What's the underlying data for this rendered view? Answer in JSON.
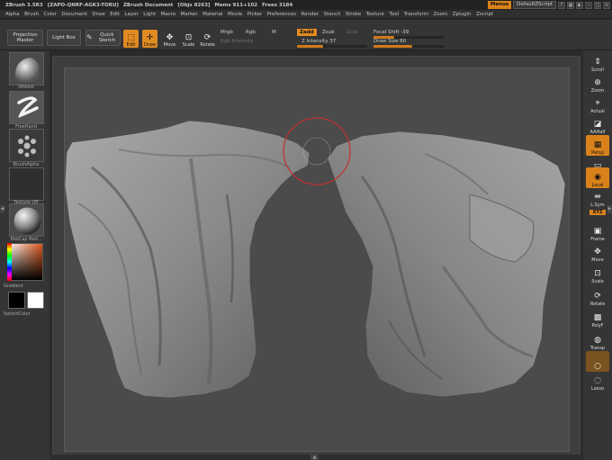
{
  "titlebar": {
    "app": "ZBrush 3.5R3",
    "serial": "[ZAPO-QNRF-AGK3-TORU]",
    "document": "ZBrush Document",
    "objs": "[Objs 8263]",
    "mems": "Mems 911+102",
    "frees": "Frees 3184",
    "menus": "Menus",
    "script": "DefaultZScript"
  },
  "menubar": [
    "Alpha",
    "Brush",
    "Color",
    "Document",
    "Draw",
    "Edit",
    "Layer",
    "Light",
    "Macro",
    "Marker",
    "Material",
    "Movie",
    "Picker",
    "Preferences",
    "Render",
    "Stencil",
    "Stroke",
    "Texture",
    "Tool",
    "Transform",
    "Zoom",
    "Zplugin",
    "Zscript"
  ],
  "toolbar": {
    "projection_master": "Projection Master",
    "light_box": "Light Box",
    "quick_sketch": "Quick Sketch",
    "edit": "Edit",
    "draw": "Draw",
    "move": "Move",
    "scale": "Scale",
    "rotate": "Rotate",
    "mrgb": "Mrgb",
    "rgb": "Rgb",
    "m": "M",
    "rgb_intensity": "Rgb Intensity",
    "zadd": "Zadd",
    "zsub": "Zsub",
    "zcut": "Zcut",
    "z_intensity_label": "Z Intensity",
    "z_intensity_value": "37",
    "focal_shift_label": "Focal Shift",
    "focal_shift_value": "-39",
    "draw_size_label": "Draw Size",
    "draw_size_value": "80"
  },
  "leftshelf": {
    "brush": "SPolish",
    "stroke": "FreeHand",
    "alpha": "BrushAlpha",
    "texture": "Texture Off",
    "material": "MatCap Red...",
    "gradient": "Gradient",
    "switch_color": "SwitchColor"
  },
  "rightshelf": [
    "Scroll",
    "Zoom",
    "Actual",
    "AAHalf",
    "Persp",
    "Floor",
    "Local",
    "L.Sym",
    "XYZ",
    "Frame",
    "Move",
    "Scale",
    "Rotate",
    "PolyF",
    "Transp",
    "Ghost",
    "Lasso"
  ],
  "colors": {
    "accent": "#e08a22",
    "background": "#353535",
    "canvas": "#4b4b4b"
  }
}
